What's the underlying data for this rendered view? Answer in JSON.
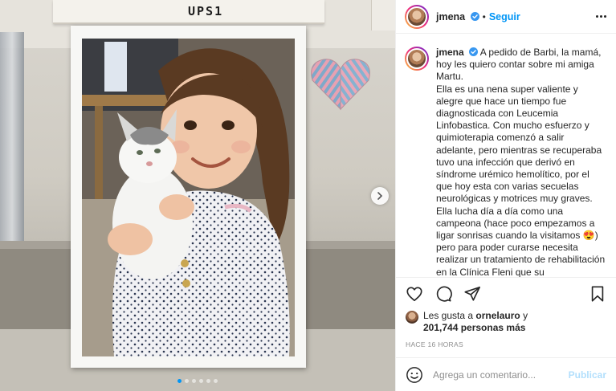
{
  "post": {
    "username": "jmena",
    "follow_label": "Seguir",
    "separator": "•",
    "caption_user": "jmena",
    "caption_text": "A pedido de Barbi, la mamá, hoy les quiero contar sobre mi amiga Martu.\nElla es una nena super valiente y alegre que hace un tiempo fue diagnosticada con Leucemia Linfobastica. Con mucho esfuerzo y quimioterapia comenzó a salir adelante, pero mientras se recuperaba tuvo una infección que derivó en síndrome urémico hemolítico, por el que hoy esta con varias secuelas neurológicas y motrices muy graves.\nElla lucha día a día como una campeona (hace poco empezamos a ligar sonrisas cuando la visitamos 😍) pero para poder curarse necesita realizar un tratamiento de rehabilitación en la Clínica Fleni que su",
    "likes_prefix": "Les gusta a ",
    "likes_user": "ornelauro",
    "likes_and": " y",
    "likes_count": "201,744 personas más",
    "time_ago": "HACE 16 HORAS",
    "comment_placeholder": "Agrega un comentario...",
    "publish_label": "Publicar"
  },
  "media": {
    "sign_text": "UPS1",
    "carousel_dots": 6,
    "active_dot": 1
  },
  "icons": {
    "verified": "verified-badge-icon",
    "like": "heart-outline-icon",
    "comment": "comment-bubble-icon",
    "share": "paper-plane-icon",
    "save": "bookmark-icon",
    "emoji": "smiley-icon",
    "next": "chevron-right-icon",
    "more": "ellipsis-icon"
  },
  "colors": {
    "accent": "#0095f6",
    "publish_disabled": "#b2dffc",
    "muted": "#8e8e8e",
    "text": "#262626"
  }
}
